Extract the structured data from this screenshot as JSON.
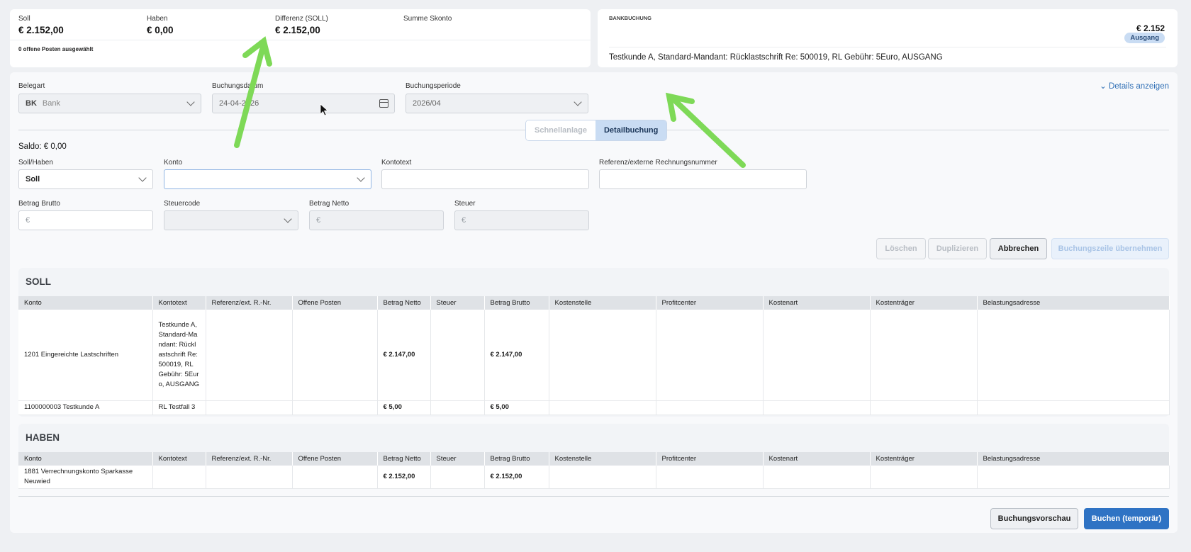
{
  "summary": {
    "soll_label": "Soll",
    "soll_value": "€ 2.152,00",
    "haben_label": "Haben",
    "haben_value": "€ 0,00",
    "diff_label": "Differenz (SOLL)",
    "diff_value": "€ 2.152,00",
    "skonto_label": "Summe Skonto",
    "note": "0 offene Posten ausgewählt"
  },
  "bank": {
    "heading": "BANKBUCHUNG",
    "amount": "€ 2.152",
    "badge": "Ausgang",
    "text": "Testkunde A, Standard-Mandant: Rücklastschrift Re: 500019, RL Gebühr: 5Euro, AUSGANG"
  },
  "form": {
    "belegart_label": "Belegart",
    "belegart_code": "BK",
    "belegart_value": "Bank",
    "datum_label": "Buchungsdatum",
    "datum_value": "24-04-2026",
    "periode_label": "Buchungsperiode",
    "periode_value": "2026/04",
    "details_link": "⌄ Details anzeigen",
    "tab_quick": "Schnellanlage",
    "tab_detail": "Detailbuchung",
    "saldo": "Saldo: € 0,00",
    "sollhaben_label": "Soll/Haben",
    "sollhaben_value": "Soll",
    "konto_label": "Konto",
    "kontotext_label": "Kontotext",
    "referenz_label": "Referenz/externe Rechnungsnummer",
    "brutto_label": "Betrag Brutto",
    "brutto_ph": "€",
    "steuercode_label": "Steuercode",
    "netto_label": "Betrag Netto",
    "netto_ph": "€",
    "steuer_label": "Steuer",
    "steuer_ph": "€"
  },
  "actions": {
    "delete": "Löschen",
    "duplicate": "Duplizieren",
    "cancel": "Abbrechen",
    "apply": "Buchungszeile übernehmen"
  },
  "columns": [
    "Konto",
    "Kontotext",
    "Referenz/ext. R.-Nr.",
    "Offene Posten",
    "Betrag Netto",
    "Steuer",
    "Betrag Brutto",
    "Kostenstelle",
    "Profitcenter",
    "Kostenart",
    "Kostenträger",
    "Belastungsadresse"
  ],
  "soll": {
    "title": "SOLL",
    "rows": [
      {
        "konto": "1201 Eingereichte Lastschriften",
        "kontotext": "Testkunde A, Standard-Mandant: Rücklastschrift Re: 500019, RL Gebühr: 5Euro, AUSGANG",
        "netto": "€ 2.147,00",
        "brutto": "€ 2.147,00"
      },
      {
        "konto": "1100000003 Testkunde A",
        "kontotext": "RL Testfall 3",
        "netto": "€ 5,00",
        "brutto": "€ 5,00"
      }
    ]
  },
  "haben": {
    "title": "HABEN",
    "rows": [
      {
        "konto": "1881 Verrechnungskonto Sparkasse Neuwied",
        "kontotext": "",
        "netto": "€ 2.152,00",
        "brutto": "€ 2.152,00"
      }
    ]
  },
  "footer": {
    "preview": "Buchungsvorschau",
    "book": "Buchen (temporär)"
  },
  "colors": {
    "accent": "#2f73c4",
    "annotation_arrow": "#7ed957"
  }
}
